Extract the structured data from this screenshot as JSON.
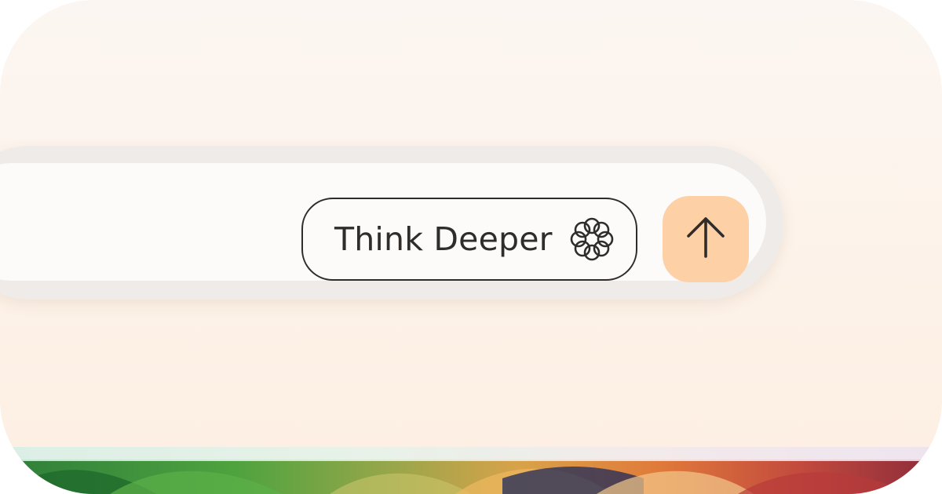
{
  "composer": {
    "input_value": "",
    "think_button_label": "Think Deeper",
    "think_icon": "flower-knot-icon",
    "send_icon": "arrow-up-icon"
  },
  "colors": {
    "background": "#fcf5ef",
    "composer_border": "#efebe8",
    "composer_fill": "#fdfbfa",
    "send_button": "#fdd0a6",
    "text": "#2f2c2a"
  }
}
